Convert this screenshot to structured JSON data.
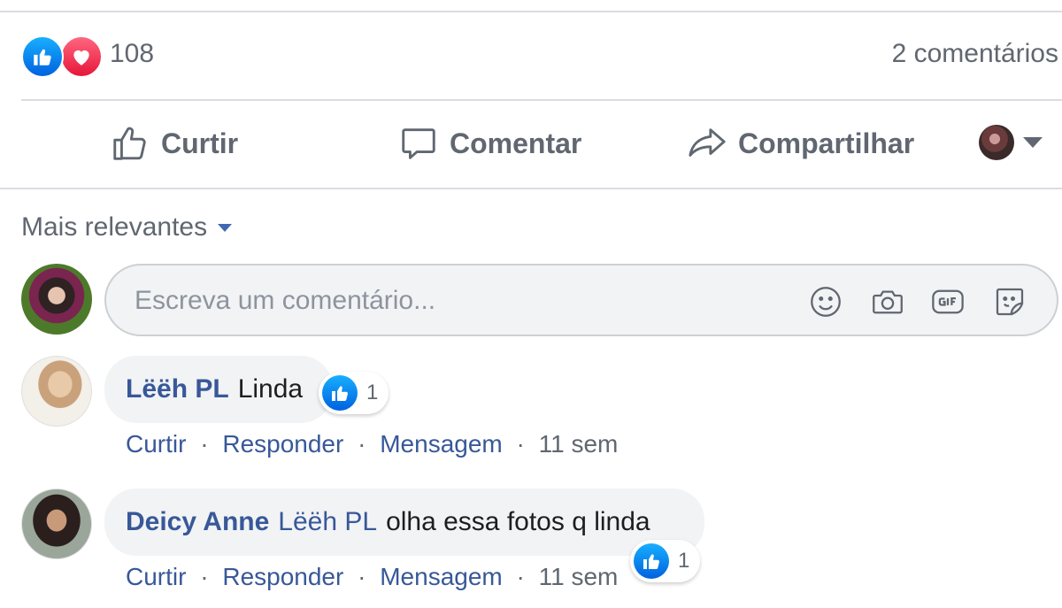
{
  "reactions": {
    "count": "108",
    "types": [
      "like",
      "love"
    ]
  },
  "comments_count": "2 comentários",
  "actions": {
    "like": "Curtir",
    "comment": "Comentar",
    "share": "Compartilhar"
  },
  "sort": {
    "label": "Mais relevantes"
  },
  "composer": {
    "placeholder": "Escreva um comentário..."
  },
  "comments": [
    {
      "author": "Lëëh PL",
      "text": "Linda",
      "likes": "1",
      "actions": {
        "like": "Curtir",
        "reply": "Responder",
        "message": "Mensagem",
        "time": "11 sem"
      },
      "separator": "·"
    },
    {
      "author": "Deicy Anne",
      "mention": "Lëëh PL",
      "text": "olha essa fotos q linda",
      "likes": "1",
      "actions": {
        "like": "Curtir",
        "reply": "Responder",
        "message": "Mensagem",
        "time": "11 sem"
      },
      "separator": "·"
    }
  ],
  "colors": {
    "link": "#385898",
    "muted": "#606770",
    "like_blue": "#0062df",
    "love_red": "#e61739"
  }
}
